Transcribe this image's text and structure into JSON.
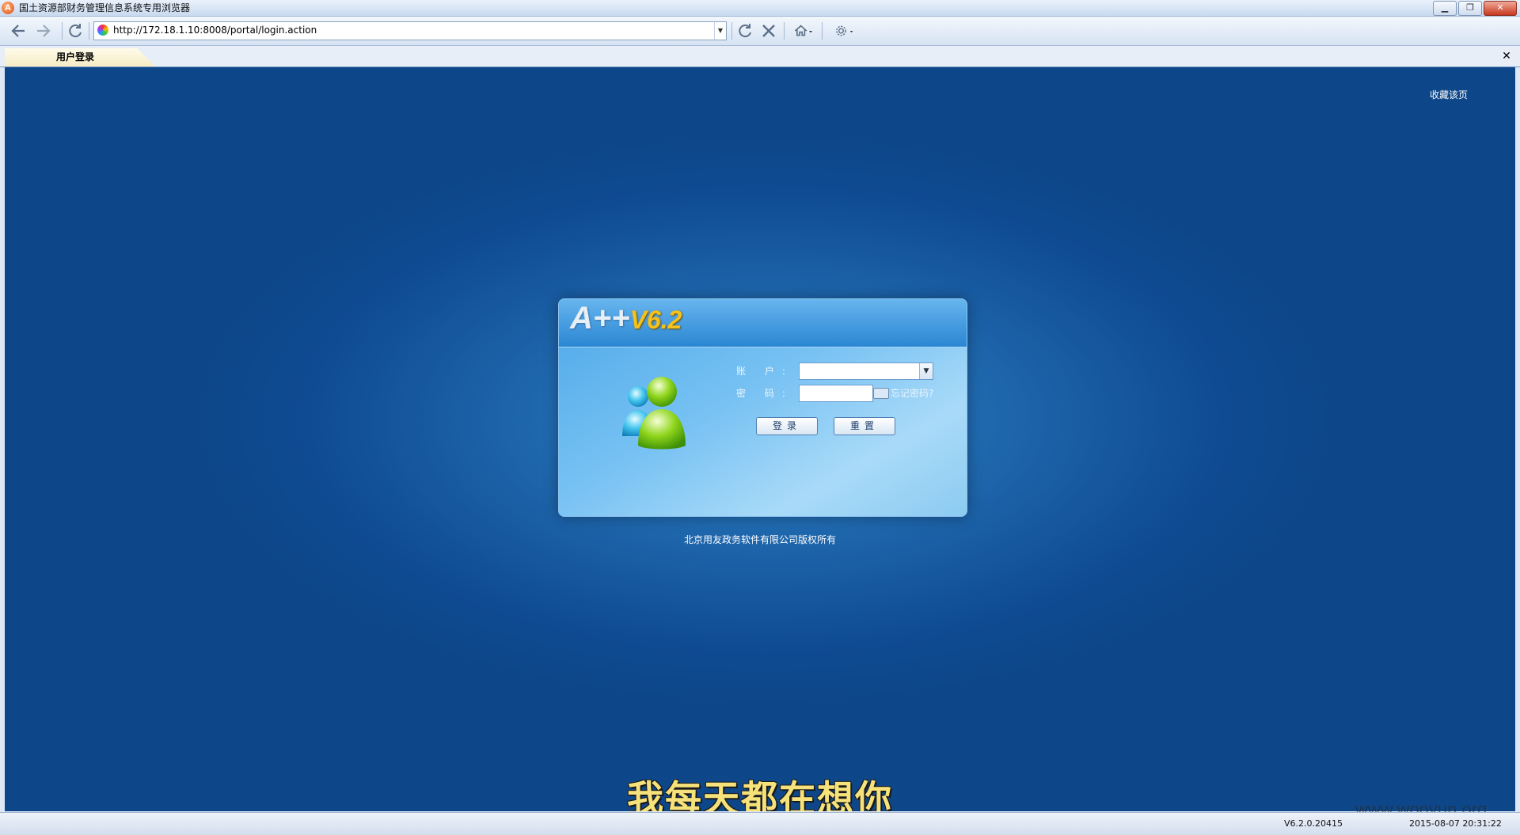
{
  "window": {
    "title": "国土资源部财务管理信息系统专用浏览器",
    "app_icon_letter": "A",
    "minimize_label": "▁",
    "restore_label": "❐",
    "close_label": "✕"
  },
  "navbar": {
    "url": "http://172.18.1.10:8008/portal/login.action"
  },
  "tabs": {
    "active_label": "用户登录",
    "close_label": "✕"
  },
  "page": {
    "bookmark_link": "收藏该页",
    "logo_a": "A++",
    "logo_v": "V6.2",
    "account_label": "账  户:",
    "password_label": "密  码:",
    "forgot_link": "忘记密码?",
    "login_button": "登录",
    "reset_button": "重置",
    "copyright": "北京用友政务软件有限公司版权所有",
    "subtitle": "我每天都在想你"
  },
  "status": {
    "version": "V6.2.0.20415",
    "datetime": "2015-08-07 20:31:22",
    "watermark": "www.wooyun.org"
  }
}
